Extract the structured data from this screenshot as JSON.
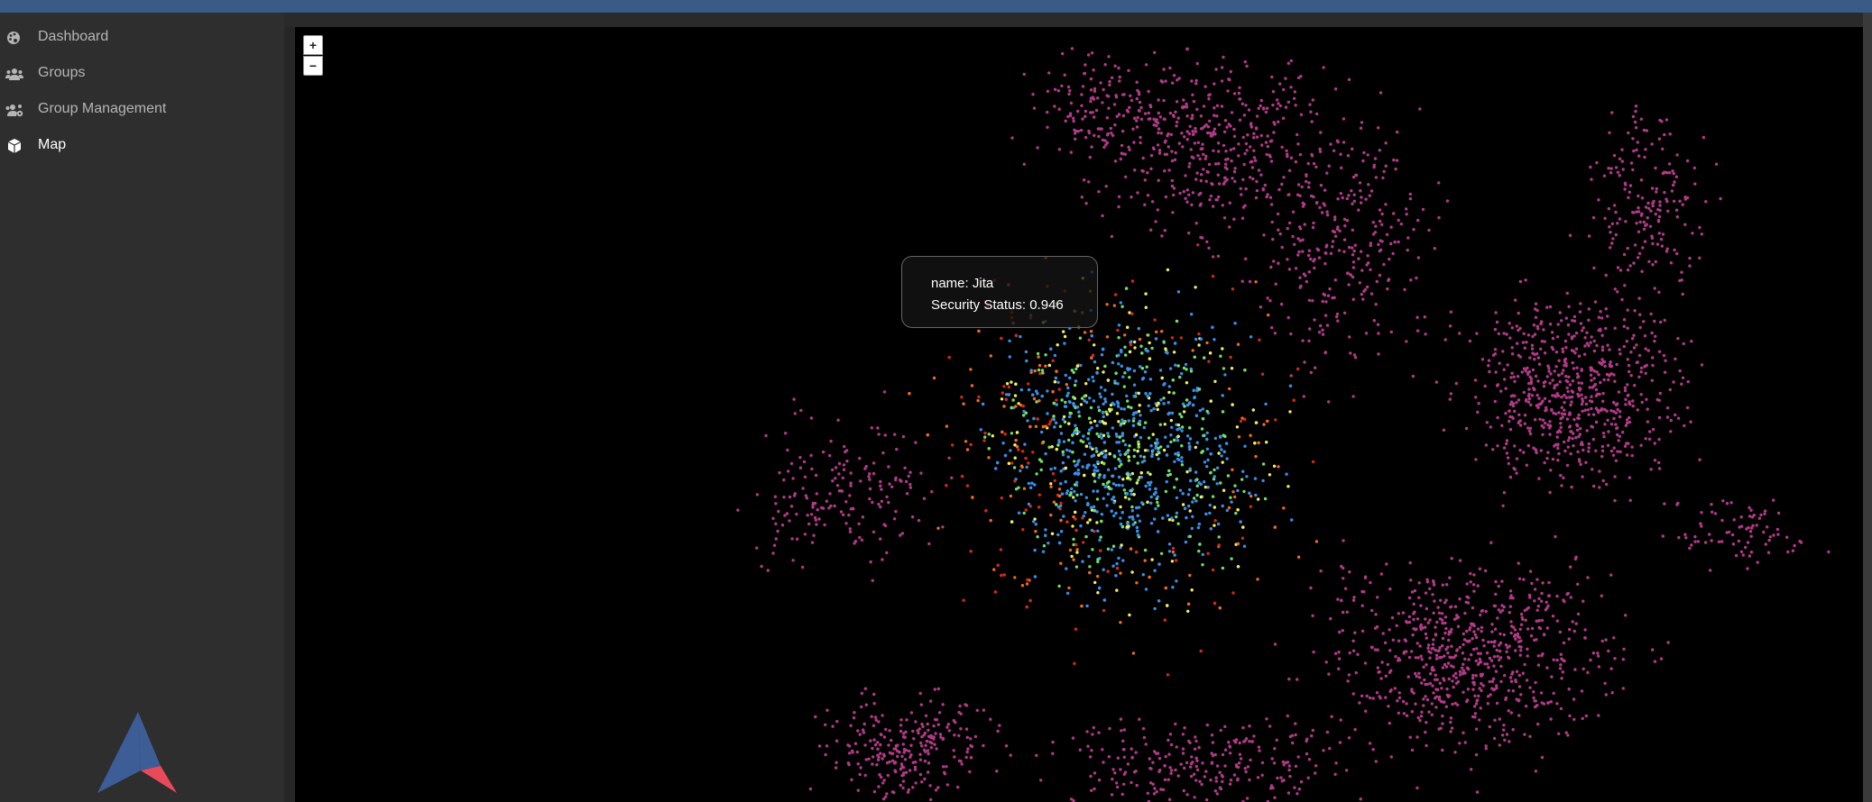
{
  "sidebar": {
    "items": [
      {
        "label": "Dashboard",
        "icon": "palette-icon",
        "active": false
      },
      {
        "label": "Groups",
        "icon": "users-icon",
        "active": false
      },
      {
        "label": "Group Management",
        "icon": "users-cog-icon",
        "active": false
      },
      {
        "label": "Map",
        "icon": "cube-icon",
        "active": true
      }
    ],
    "logo": "app-logo"
  },
  "map": {
    "zoom_in_label": "+",
    "zoom_out_label": "−",
    "tooltip": {
      "name_line": "name: Jita",
      "security_line": "Security Status: 0.946"
    },
    "colors": {
      "background": "#000000",
      "nullsec": "#b03a86",
      "highsec_high": "#3a8ee8",
      "highsec_mid": "#6fe06a",
      "highsec_low": "#f0f060",
      "lowsec": "#f06a20",
      "lowsec_low": "#d02a1a"
    }
  },
  "colors": {
    "topbar": "#3a5a87",
    "sidebar_bg": "#2e2e2e",
    "nav_text": "#b5b5b5",
    "nav_text_active": "#ffffff",
    "logo_blue": "#3d5d97",
    "logo_red": "#e84a5a"
  }
}
